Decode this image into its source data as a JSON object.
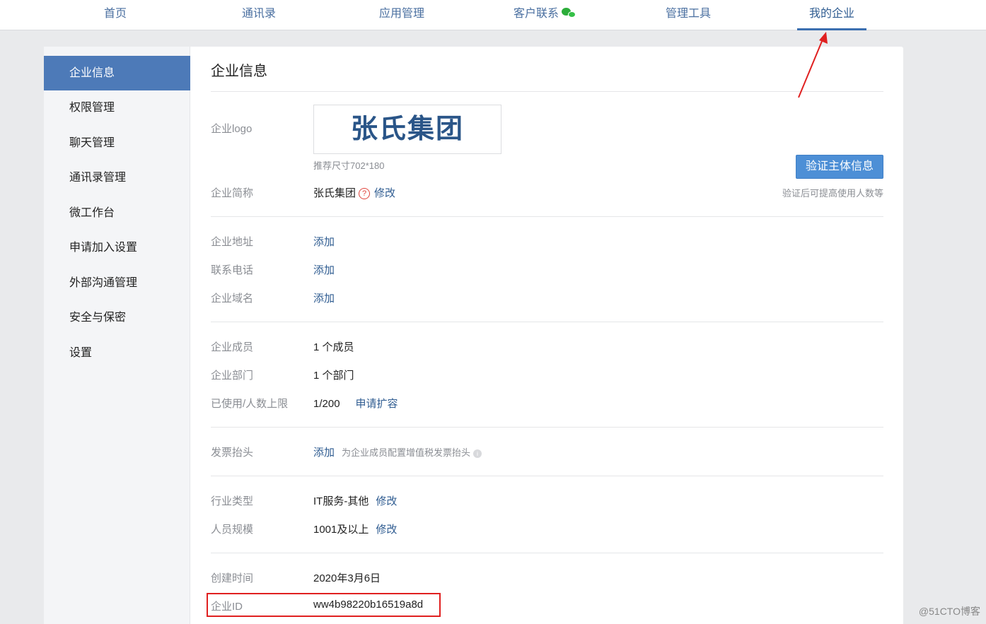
{
  "topnav": {
    "items": [
      {
        "label": "首页"
      },
      {
        "label": "通讯录"
      },
      {
        "label": "应用管理"
      },
      {
        "label": "客户联系"
      },
      {
        "label": "管理工具"
      },
      {
        "label": "我的企业"
      }
    ],
    "active": "我的企业",
    "wechat_icon": "wechat-icon"
  },
  "sidebar": {
    "items": [
      {
        "label": "企业信息"
      },
      {
        "label": "权限管理"
      },
      {
        "label": "聊天管理"
      },
      {
        "label": "通讯录管理"
      },
      {
        "label": "微工作台"
      },
      {
        "label": "申请加入设置"
      },
      {
        "label": "外部沟通管理"
      },
      {
        "label": "安全与保密"
      },
      {
        "label": "设置"
      }
    ],
    "active": "企业信息"
  },
  "content": {
    "title": "企业信息",
    "logo": {
      "label": "企业logo",
      "text": "张氏集团",
      "hint": "推荐尺寸702*180"
    },
    "verify": {
      "button": "验证主体信息",
      "hint": "验证后可提高使用人数等"
    },
    "short_name": {
      "label": "企业简称",
      "value": "张氏集团",
      "help_icon": "?",
      "action": "修改"
    },
    "address": {
      "label": "企业地址",
      "action": "添加"
    },
    "phone": {
      "label": "联系电话",
      "action": "添加"
    },
    "domain": {
      "label": "企业域名",
      "action": "添加"
    },
    "members": {
      "label": "企业成员",
      "value": "1 个成员"
    },
    "departments": {
      "label": "企业部门",
      "value": "1 个部门"
    },
    "usage": {
      "label": "已使用/人数上限",
      "value": "1/200",
      "action": "申请扩容"
    },
    "invoice": {
      "label": "发票抬头",
      "action": "添加",
      "note": "为企业成员配置增值税发票抬头",
      "info_icon": "i"
    },
    "industry": {
      "label": "行业类型",
      "value": "IT服务-其他",
      "action": "修改"
    },
    "scale": {
      "label": "人员规模",
      "value": "1001及以上",
      "action": "修改"
    },
    "created": {
      "label": "创建时间",
      "value": "2020年3月6日"
    },
    "corp_id": {
      "label": "企业ID",
      "value": "ww4b98220b16519a8d"
    }
  },
  "annotation_color": "#e02020",
  "watermark": "@51CTO博客"
}
